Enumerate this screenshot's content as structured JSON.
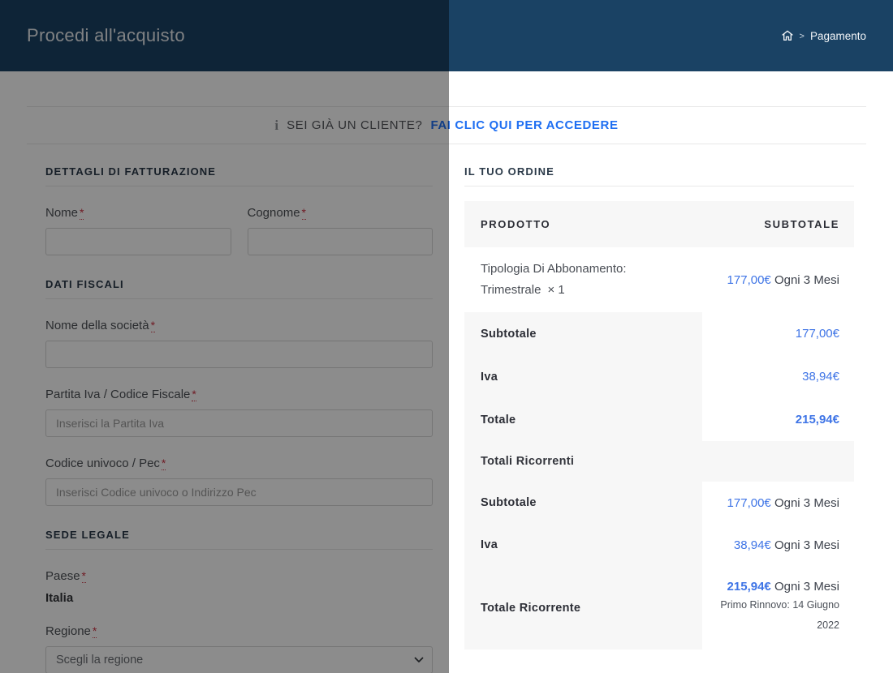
{
  "header": {
    "title": "Procedi all'acquisto",
    "breadcrumb": {
      "separator": ">",
      "current": "Pagamento"
    }
  },
  "notice": {
    "info_icon_glyph": "i",
    "prompt": "SEI GIÀ UN CLIENTE?",
    "link_label": "FAI CLIC QUI PER ACCEDERE"
  },
  "billing": {
    "required_mark": "*",
    "sections": {
      "billing_details": "DETTAGLI DI FATTURAZIONE",
      "fiscal_data": "DATI FISCALI",
      "registered_office": "SEDE LEGALE"
    },
    "fields": {
      "nome": {
        "label": "Nome",
        "value": ""
      },
      "cognome": {
        "label": "Cognome",
        "value": ""
      },
      "societa": {
        "label": "Nome della società",
        "value": ""
      },
      "partita_iva": {
        "label": "Partita Iva / Codice Fiscale",
        "placeholder": "Inserisci la Partita Iva"
      },
      "codice_univoco": {
        "label": "Codice univoco / Pec",
        "placeholder": "Inserisci Codice univoco o Indirizzo Pec"
      },
      "paese": {
        "label": "Paese",
        "value": "Italia"
      },
      "regione": {
        "label": "Regione",
        "selected_option": "Scegli la regione"
      }
    }
  },
  "order": {
    "heading": "IL TUO ORDINE",
    "columns": {
      "product": "PRODOTTO",
      "subtotal": "SUBTOTALE"
    },
    "item": {
      "name_line1": "Tipologia Di Abbonamento:",
      "name_line2": "Trimestrale",
      "quantity": "× 1",
      "price": "177,00€",
      "period": "Ogni 3 Mesi"
    },
    "totals": {
      "subtotal": {
        "label": "Subtotale",
        "value": "177,00€"
      },
      "vat": {
        "label": "Iva",
        "value": "38,94€"
      },
      "total": {
        "label": "Totale",
        "value": "215,94€"
      },
      "recurring_heading": "Totali Ricorrenti",
      "recurring_subtotal": {
        "label": "Subtotale",
        "value": "177,00€",
        "period": "Ogni 3 Mesi"
      },
      "recurring_vat": {
        "label": "Iva",
        "value": "38,94€",
        "period": "Ogni 3 Mesi"
      },
      "recurring_total": {
        "label": "Totale Ricorrente",
        "value": "215,94€",
        "period": "Ogni 3 Mesi",
        "note": "Primo Rinnovo: 14 Giugno 2022"
      }
    }
  },
  "colors": {
    "header_bg": "#1a4264",
    "link_blue": "#1f6ff2",
    "price_blue": "#3e74e6",
    "required_red": "#cc3344",
    "row_gray": "#f7f7f7"
  }
}
